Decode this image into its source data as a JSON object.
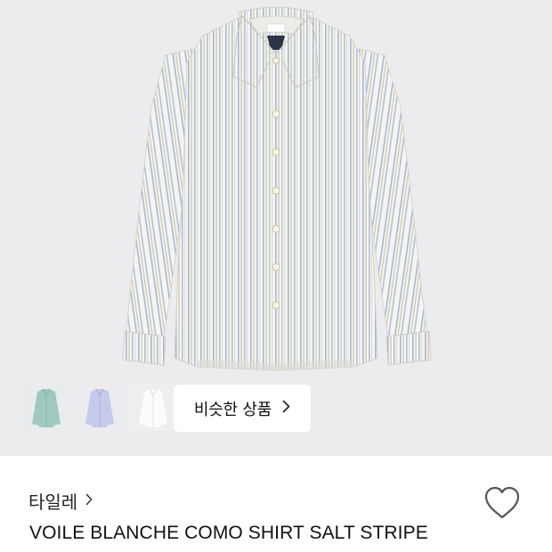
{
  "product_image": {
    "alt": "",
    "background": "#ececee",
    "garment_color": "#f3f3f0",
    "stripe_colors": [
      "#9fb2cf",
      "#c9c3a2",
      "#b8c3d6"
    ]
  },
  "color_options": [
    {
      "swatch": "#9fc9c2"
    },
    {
      "swatch": "#c9cdeb"
    },
    {
      "swatch": "#f7f7f7"
    }
  ],
  "similar_button": {
    "label": "비슷한 상품",
    "icon": "chevron-right-icon"
  },
  "brand": {
    "name": "타일레",
    "icon": "chevron-right-icon"
  },
  "product": {
    "title": "VOILE BLANCHE COMO SHIRT SALT STRIPE"
  },
  "wishlist": {
    "icon": "heart-outline-icon"
  }
}
